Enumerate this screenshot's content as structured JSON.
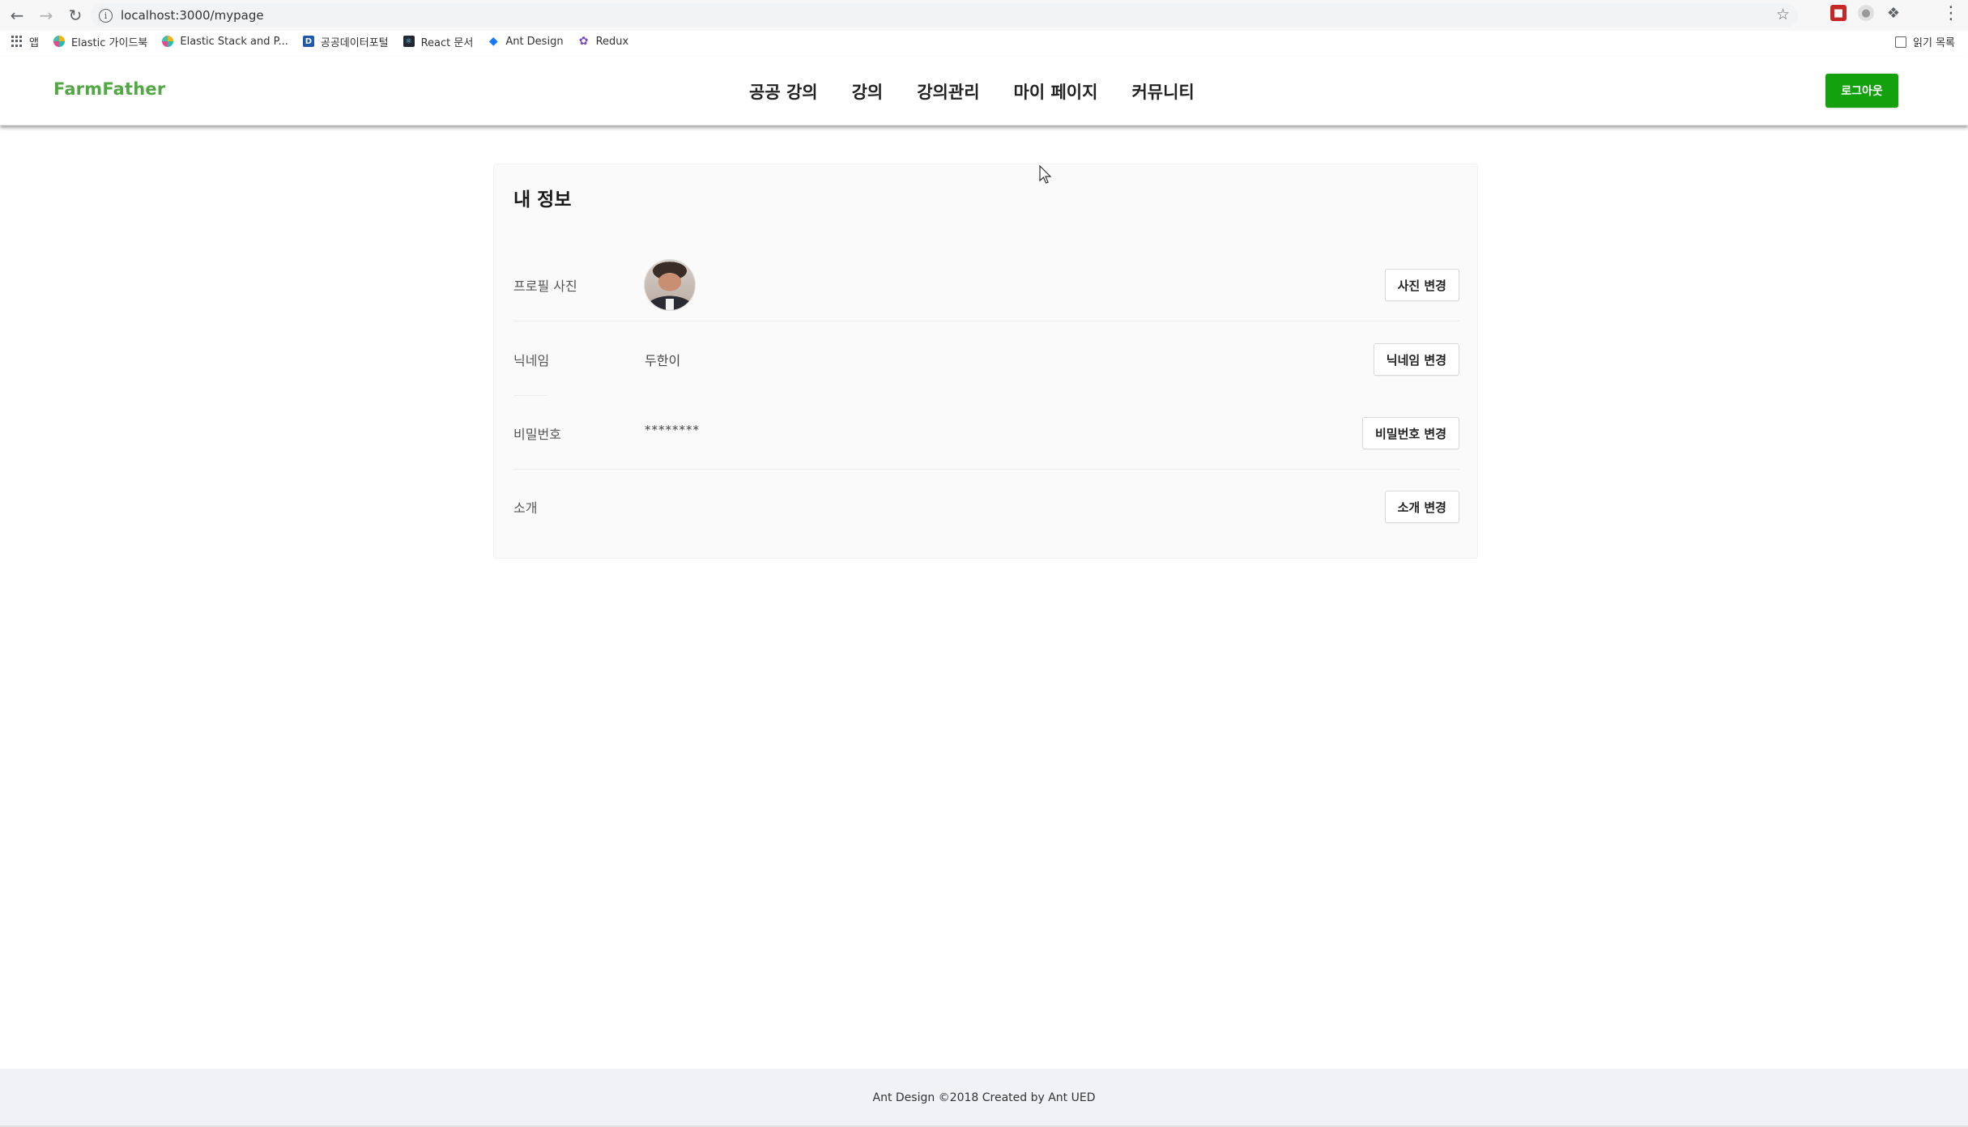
{
  "browser": {
    "url": "localhost:3000/mypage",
    "bookmarks": [
      {
        "label": "앱",
        "icon": "apps-icon"
      },
      {
        "label": "Elastic 가이드북",
        "icon": "elastic-icon"
      },
      {
        "label": "Elastic Stack and P...",
        "icon": "elastic-icon"
      },
      {
        "label": "공공데이터포털",
        "icon": "data-portal-icon"
      },
      {
        "label": "React 문서",
        "icon": "react-icon"
      },
      {
        "label": "Ant Design",
        "icon": "ant-design-icon"
      },
      {
        "label": "Redux",
        "icon": "redux-icon"
      }
    ],
    "reading_list_label": "읽기 목록"
  },
  "header": {
    "logo": "FarmFather",
    "nav": [
      "공공 강의",
      "강의",
      "강의관리",
      "마이 페이지",
      "커뮤니티"
    ],
    "logout_label": "로그아웃",
    "logo_color": "#52a845",
    "logout_color": "#13a10e"
  },
  "profile": {
    "title": "내 정보",
    "rows": [
      {
        "label": "프로필 사진",
        "value": "",
        "button": "사진 변경"
      },
      {
        "label": "닉네임",
        "value": "두한이",
        "button": "닉네임 변경"
      },
      {
        "label": "비밀번호",
        "value": "********",
        "button": "비밀번호 변경"
      },
      {
        "label": "소개",
        "value": "",
        "button": "소개 변경"
      }
    ]
  },
  "footer": {
    "text": "Ant Design ©2018 Created by Ant UED"
  }
}
